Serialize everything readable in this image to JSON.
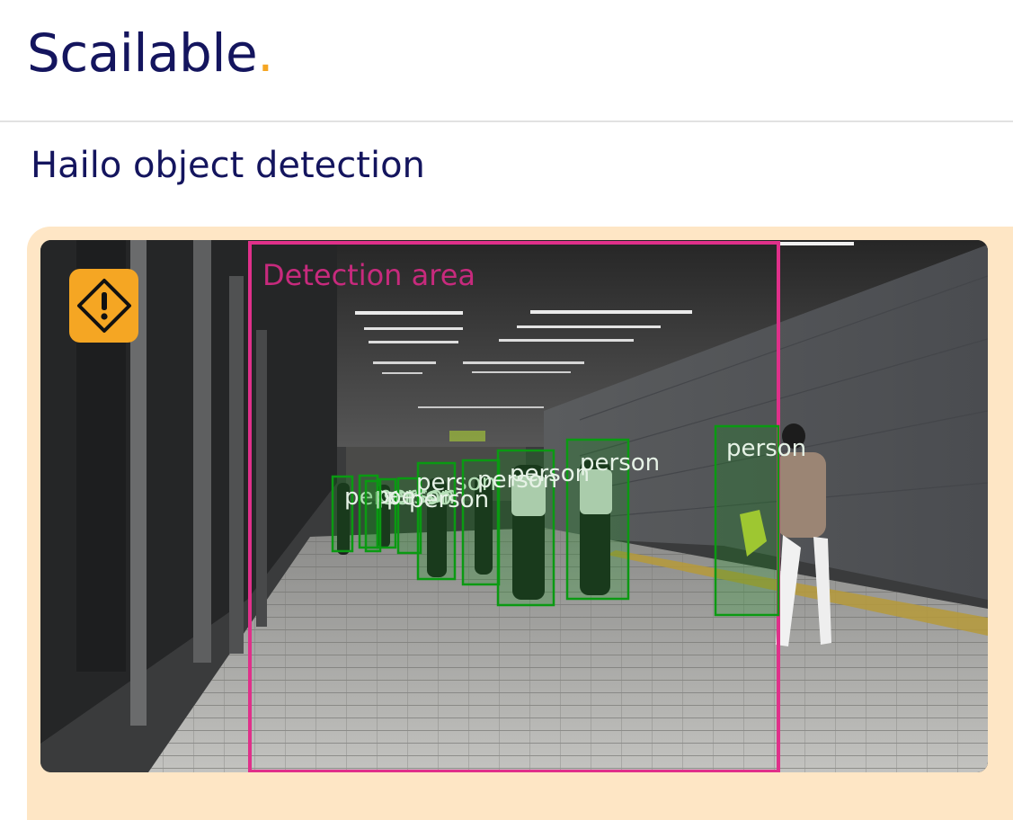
{
  "brand": {
    "name": "Scailable",
    "dot": ".",
    "accent": "#f5a623",
    "primary": "#14155e"
  },
  "page": {
    "title": "Hailo object detection"
  },
  "video": {
    "area_label": "Detection area",
    "area_color": "#e0308a",
    "box_color": "#0a9a12",
    "detections": [
      {
        "label": "person"
      },
      {
        "label": "person"
      },
      {
        "label": "person"
      },
      {
        "label": "person"
      },
      {
        "label": "person"
      },
      {
        "label": "person"
      },
      {
        "label": "person"
      },
      {
        "label": "person"
      },
      {
        "label": "person"
      },
      {
        "label": "person"
      }
    ]
  },
  "icons": {
    "warning": "warning-diamond-icon"
  },
  "colors": {
    "panel_bg": "#fee6c5",
    "badge_bg": "#f5a623"
  }
}
